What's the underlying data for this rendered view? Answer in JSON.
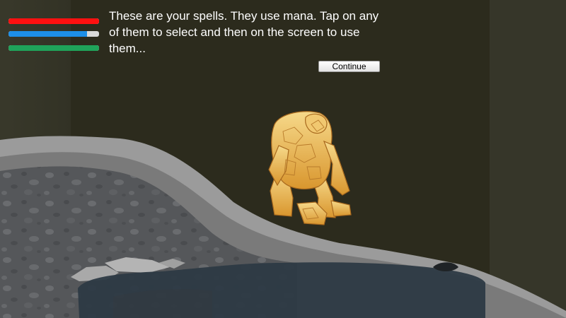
{
  "hud": {
    "health": {
      "level": 1.0,
      "color": "#ff1010"
    },
    "mana": {
      "level": 0.87,
      "color": "#1d8fe8"
    },
    "stamina": {
      "level": 1.0,
      "color": "#1fa35a"
    }
  },
  "tutorial": {
    "message": "These are your spells. They use mana. Tap on any of them to select and then on the screen to use them...",
    "continue_label": "Continue"
  },
  "colors": {
    "background": "#2c2b1d",
    "ground_band": "#9a9a9a",
    "cave_rock": "#55575a",
    "water": "#2d3a44",
    "golem": "#e9b253"
  }
}
